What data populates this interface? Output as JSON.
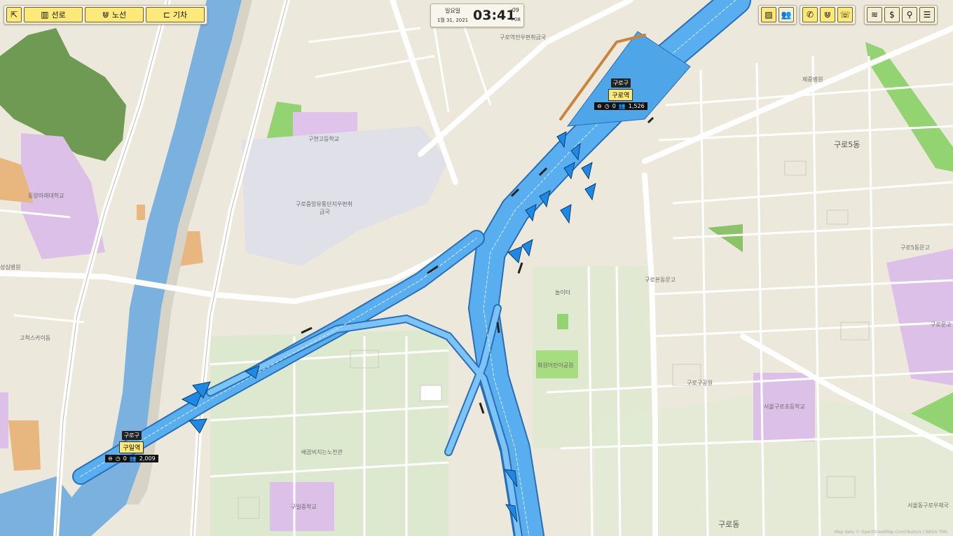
{
  "toolbar_left": {
    "select_icon": "pointer-cursor-icon",
    "tracks_label": "선로",
    "lines_label": "노선",
    "trains_label": "기차"
  },
  "clock": {
    "weekday": "일요일",
    "date": "1월 31, 2021",
    "time": "03:41",
    "seconds": ":09",
    "timezone": "+08"
  },
  "toolbar_right": {
    "icons": [
      "map-layer-icon",
      "passengers-icon",
      "phone-icon",
      "route-icon",
      "signal-phone-icon",
      "wifi-icon",
      "money-icon",
      "search-icon",
      "menu-icon"
    ],
    "money_glyph": "$"
  },
  "stations": [
    {
      "district": "구로구",
      "name": "구로역",
      "waiting": "0",
      "passengers": "1,526"
    },
    {
      "district": "구로구",
      "name": "구일역",
      "waiting": "0",
      "passengers": "2,009"
    }
  ],
  "map_labels": {
    "guro_post_office": "구로역전우편취급국",
    "jesaeng_hospital": "제중병원",
    "guro5dong": "구로5동",
    "guhyeon_highschool": "구현고등학교",
    "dongyang_college": "동양미래대학교",
    "guro_central_post": "구로중앙유통단지우편취",
    "guro_central_post2": "급국",
    "guro5dong_park": "구로5동문고",
    "guro_culture": "구로문고",
    "hospital_left": "성심병원",
    "playground": "놀이터",
    "gurobon_dong": "구로본동문고",
    "gocheok_sky": "고척스카이돔",
    "hwawon_park": "화원어린이공원",
    "guro_park": "구로구공원",
    "seoul_guro_elem": "서울구로초등학교",
    "baegumbeji": "배꼽비지는노천관",
    "guil_middle": "구일중학교",
    "gurodong": "구로동",
    "seoul_guro_post": "서울동구로우체국",
    "attribution": "Map data © OpenStreetMap Contributors | NASA TMS"
  }
}
